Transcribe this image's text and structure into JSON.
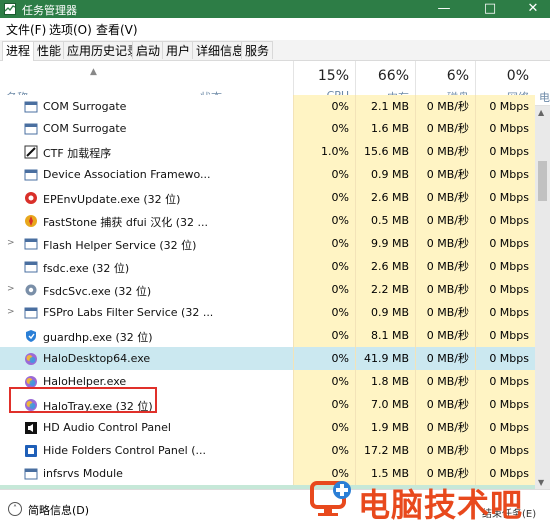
{
  "window": {
    "title": "任务管理器",
    "minimize": "—",
    "maximize": "□",
    "close": "✕"
  },
  "menu": [
    "文件(F)",
    "选项(O)",
    "查看(V)"
  ],
  "tabs": [
    "进程",
    "性能",
    "应用历史记录",
    "启动",
    "用户",
    "详细信息",
    "服务"
  ],
  "header": {
    "name": "名称",
    "status": "状态",
    "cpu": {
      "pct": "15%",
      "label": "CPU"
    },
    "memory": {
      "pct": "66%",
      "label": "内存"
    },
    "disk": {
      "pct": "6%",
      "label": "磁盘"
    },
    "network": {
      "pct": "0%",
      "label": "网络"
    },
    "next": "电"
  },
  "rows": [
    {
      "name": "COM Surrogate",
      "cpu": "0%",
      "mem": "1.6 MB",
      "disk": "0 MB/秒",
      "net": "0 Mbps",
      "expand": "",
      "icon": "app-window-icon"
    },
    {
      "name": "CTF 加载程序",
      "cpu": "1.0%",
      "mem": "15.6 MB",
      "disk": "0 MB/秒",
      "net": "0 Mbps",
      "expand": "",
      "icon": "ctf-pen-icon"
    },
    {
      "name": "Device Association Framewo...",
      "cpu": "0%",
      "mem": "0.9 MB",
      "disk": "0 MB/秒",
      "net": "0 Mbps",
      "expand": "",
      "icon": "app-window-icon"
    },
    {
      "name": "EPEnvUpdate.exe (32 位)",
      "cpu": "0%",
      "mem": "2.6 MB",
      "disk": "0 MB/秒",
      "net": "0 Mbps",
      "expand": "",
      "icon": "red-circle-icon"
    },
    {
      "name": "FastStone 捕获 dfui 汉化 (32 ...",
      "cpu": "0%",
      "mem": "0.5 MB",
      "disk": "0 MB/秒",
      "net": "0 Mbps",
      "expand": "",
      "icon": "faststone-icon"
    },
    {
      "name": "Flash Helper Service (32 位)",
      "cpu": "0%",
      "mem": "9.9 MB",
      "disk": "0 MB/秒",
      "net": "0 Mbps",
      "expand": ">",
      "icon": "app-window-icon"
    },
    {
      "name": "fsdc.exe (32 位)",
      "cpu": "0%",
      "mem": "2.6 MB",
      "disk": "0 MB/秒",
      "net": "0 Mbps",
      "expand": "",
      "icon": "app-window-icon"
    },
    {
      "name": "FsdcSvc.exe (32 位)",
      "cpu": "0%",
      "mem": "2.2 MB",
      "disk": "0 MB/秒",
      "net": "0 Mbps",
      "expand": ">",
      "icon": "gear-icon"
    },
    {
      "name": "FSPro Labs Filter Service (32 ...",
      "cpu": "0%",
      "mem": "0.9 MB",
      "disk": "0 MB/秒",
      "net": "0 Mbps",
      "expand": ">",
      "icon": "app-window-icon"
    },
    {
      "name": "guardhp.exe (32 位)",
      "cpu": "0%",
      "mem": "8.1 MB",
      "disk": "0 MB/秒",
      "net": "0 Mbps",
      "expand": "",
      "icon": "shield-icon"
    },
    {
      "name": "HaloDesktop64.exe",
      "cpu": "0%",
      "mem": "41.9 MB",
      "disk": "0 MB/秒",
      "net": "0 Mbps",
      "expand": "",
      "icon": "halo-icon"
    },
    {
      "name": "HaloHelper.exe",
      "cpu": "0%",
      "mem": "1.8 MB",
      "disk": "0 MB/秒",
      "net": "0 Mbps",
      "expand": "",
      "icon": "halo-icon"
    },
    {
      "name": "HaloTray.exe (32 位)",
      "cpu": "0%",
      "mem": "7.0 MB",
      "disk": "0 MB/秒",
      "net": "0 Mbps",
      "expand": "",
      "icon": "halo-icon"
    },
    {
      "name": "HD Audio Control Panel",
      "cpu": "0%",
      "mem": "1.9 MB",
      "disk": "0 MB/秒",
      "net": "0 Mbps",
      "expand": "",
      "icon": "audio-icon"
    },
    {
      "name": "Hide Folders Control Panel (...",
      "cpu": "0%",
      "mem": "17.2 MB",
      "disk": "0 MB/秒",
      "net": "0 Mbps",
      "expand": "",
      "icon": "hide-folders-icon"
    }
  ],
  "partial_top": {
    "name": "COM Surrogate",
    "cpu": "0%",
    "mem": "2.1 MB",
    "disk": "0 MB/秒",
    "net": "0 Mbps"
  },
  "partial_bottom": {
    "name": "infsrvs Module",
    "cpu": "0%",
    "mem": "1.5 MB",
    "disk": "0 MB/秒",
    "net": "0 Mbps"
  },
  "footer": {
    "brief": "简略信息(D)",
    "end_task": "结束任务(E)"
  },
  "watermark": {
    "text": "电脑技术吧"
  },
  "colors": {
    "titlebar": "#2d7d46",
    "usage_cell": "#fff4c4",
    "selected_row": "#cbe8f0",
    "red_box": "#e0302a",
    "watermark": "#e8491d"
  }
}
